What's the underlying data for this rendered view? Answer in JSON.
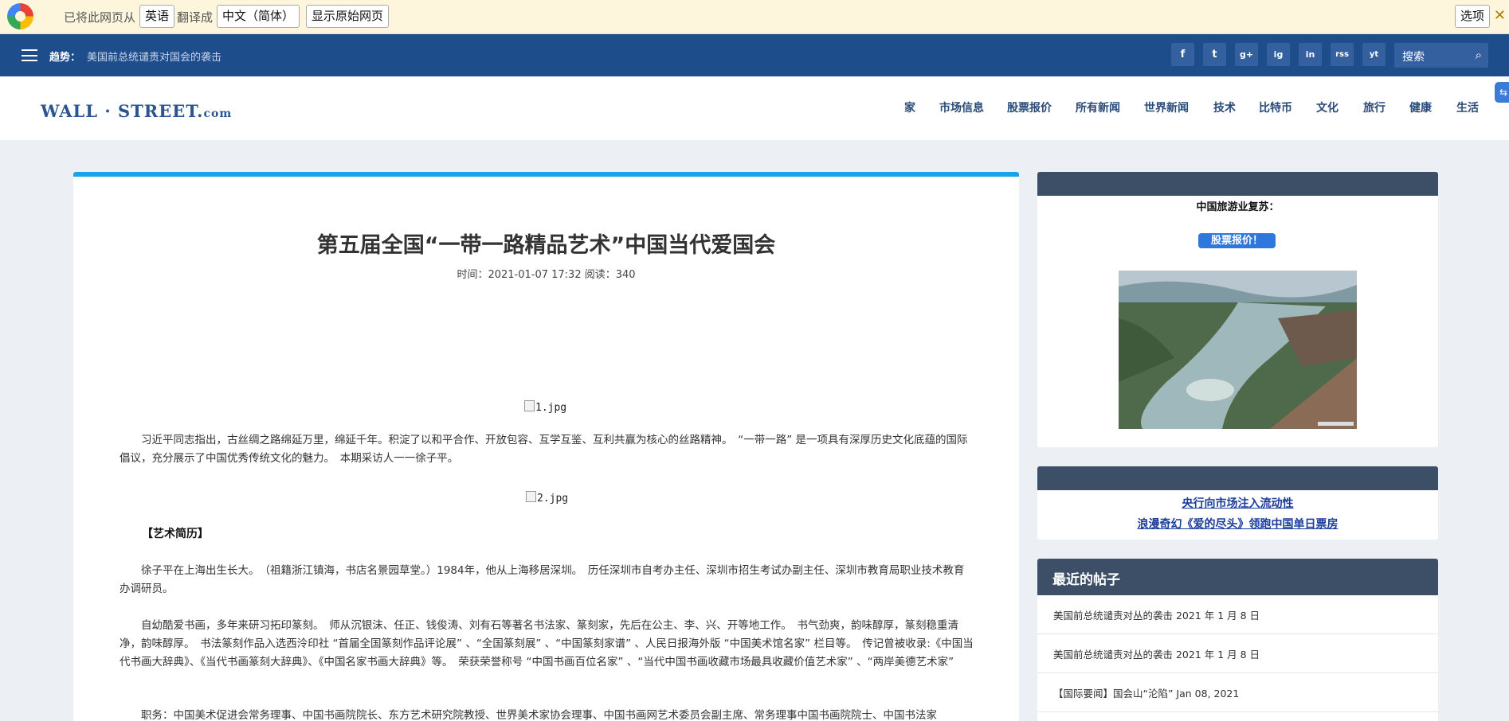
{
  "translate_bar": {
    "prefix": "已将此网页从",
    "source_lang": "英语",
    "middle": "翻译成",
    "target_lang": "中文（简体）",
    "show_original": "显示原始网页",
    "options": "选项",
    "close": "✕"
  },
  "topbar": {
    "trend_label": "趋势：",
    "trend_text": "美国前总统谴责对国会的袭击",
    "social": [
      "f",
      "t",
      "g+",
      "ig",
      "in",
      "rss",
      "yt"
    ],
    "search_placeholder": "搜索"
  },
  "header": {
    "brand_main": "WALL · STREET.",
    "brand_suffix": "com",
    "menu": [
      "家",
      "市场信息",
      "股票报价",
      "所有新闻",
      "世界新闻",
      "技术",
      "比特币",
      "文化",
      "旅行",
      "健康",
      "生活"
    ]
  },
  "article": {
    "title": "第五届全国“一带一路精品艺术”中国当代爱国会",
    "meta": "时间：2021-01-07 17:32 阅读：340",
    "img1": "1.jpg",
    "p1": "习近平同志指出，古丝绸之路绵延万里，绵延千年。积淀了以和平合作、开放包容、互学互鉴、互利共赢为核心的丝路精神。　“一带一路” 是一项具有深厚历史文化底蕴的国际倡议，充分展示了中国优秀传统文化的魅力。　本期采访人一一徐子平。",
    "img2": "2.jpg",
    "section1": "【艺术简历】",
    "p2": "徐子平在上海出生长大。　（祖籍浙江镇海，书店名景园草堂。）1984年，他从上海移居深圳。　历任深圳市自考办主任、深圳市招生考试办副主任、深圳市教育局职业技术教育办调研员。",
    "p3": "自幼酷爱书画，多年来研习拓印篆刻。　师从沉银沫、任正、钱俊涛、刘有石等著名书法家、篆刻家，先后在公主、李、兴、开等地工作。　书气劲爽，韵味醇厚，篆刻稳重清净，韵味醇厚。　书法篆刻作品入选西泠印社 “首届全国篆刻作品评论展” 、“全国篆刻展” 、“中国篆刻家谱” 、人民日报海外版 “中国美术馆名家” 栏目等。　传记曾被收录:《中国当代书画大辞典》、《当代书画篆刻大辞典》、《中国名家书画大辞典》等。　荣获荣誉称号 “中国书画百位名家” 、“当代中国书画收藏市场最具收藏价值艺术家” 、“两岸美德艺术家”",
    "p4": "职务：中国美术促进会常务理事、中国书画院院长、东方艺术研究院教授、世界美术家协会理事、中国书画网艺术委员会副主席、常务理事中国书画院院士、中国书法家"
  },
  "sidebar": {
    "card1_title": "中国旅游业复苏：",
    "card1_button": "股票报价！",
    "card1_image_alt": "aerial-river-town-photo",
    "card2_links": [
      "央行向市场注入流动性",
      "浪漫奇幻《爱的尽头》领跑中国单日票房"
    ],
    "recent_title": "最近的帖子",
    "recent_posts": [
      "美国前总统谴责对丛的袭击 2021 年 1 月 8 日",
      "美国前总统谴责对丛的袭击 2021 年 1 月 8 日",
      "【国际要闻】国会山“沦陷” Jan 08, 2021"
    ]
  },
  "colors": {
    "nav": "#1e4d8c",
    "accent": "#1aa3e8",
    "card_header": "#3d4f66",
    "button": "#2e78dd"
  }
}
